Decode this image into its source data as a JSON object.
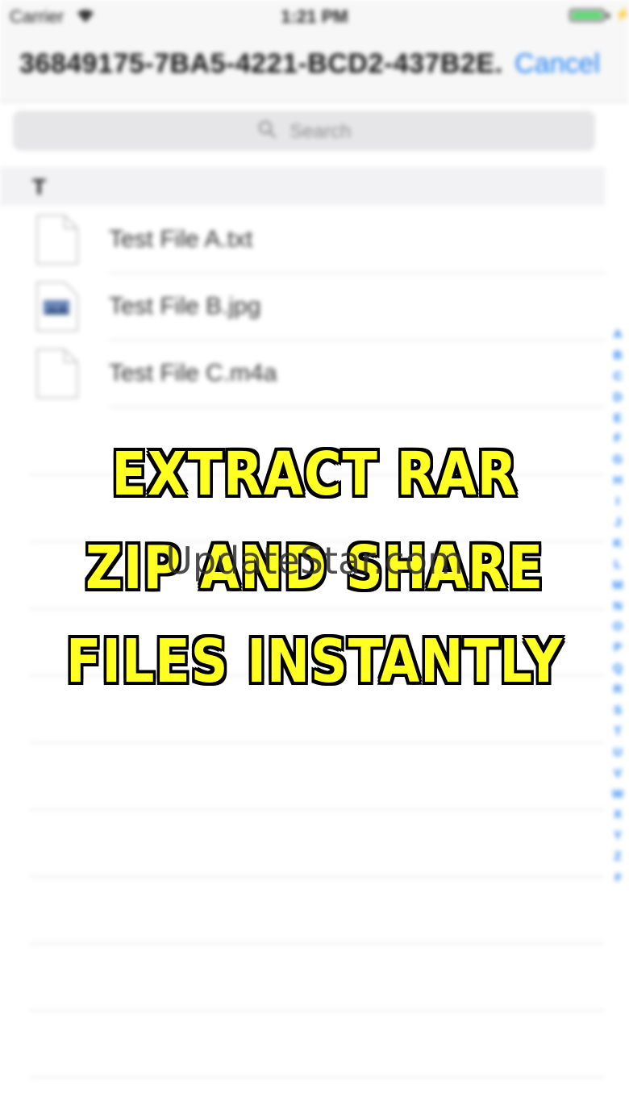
{
  "status_bar": {
    "carrier": "Carrier",
    "time": "1:21 PM",
    "wifi_icon": "wifi-icon",
    "battery_icon": "battery-icon",
    "battery_color": "#4cd964"
  },
  "nav": {
    "title": "36849175-7BA5-4221-BCD2-437B2E...",
    "cancel_label": "Cancel",
    "accent_color": "#1e7ff5"
  },
  "search": {
    "placeholder": "Search",
    "icon": "search-icon"
  },
  "section": {
    "letter": "T"
  },
  "files": [
    {
      "name": "Test File A.txt",
      "icon": "text-file-icon"
    },
    {
      "name": "Test File B.jpg",
      "icon": "image-file-icon"
    },
    {
      "name": "Test File C.m4a",
      "icon": "audio-file-icon"
    }
  ],
  "index_letters": [
    "A",
    "B",
    "C",
    "D",
    "E",
    "F",
    "G",
    "H",
    "I",
    "J",
    "K",
    "L",
    "M",
    "N",
    "O",
    "P",
    "Q",
    "R",
    "S",
    "T",
    "U",
    "V",
    "W",
    "X",
    "Y",
    "Z",
    "#"
  ],
  "overlay": {
    "line1": "EXTRACT RAR",
    "line2": "ZIP AND SHARE",
    "line3": "FILES INSTANTLY",
    "text_color": "#ffff22"
  },
  "watermark": {
    "text": "UpdateStar.com"
  }
}
